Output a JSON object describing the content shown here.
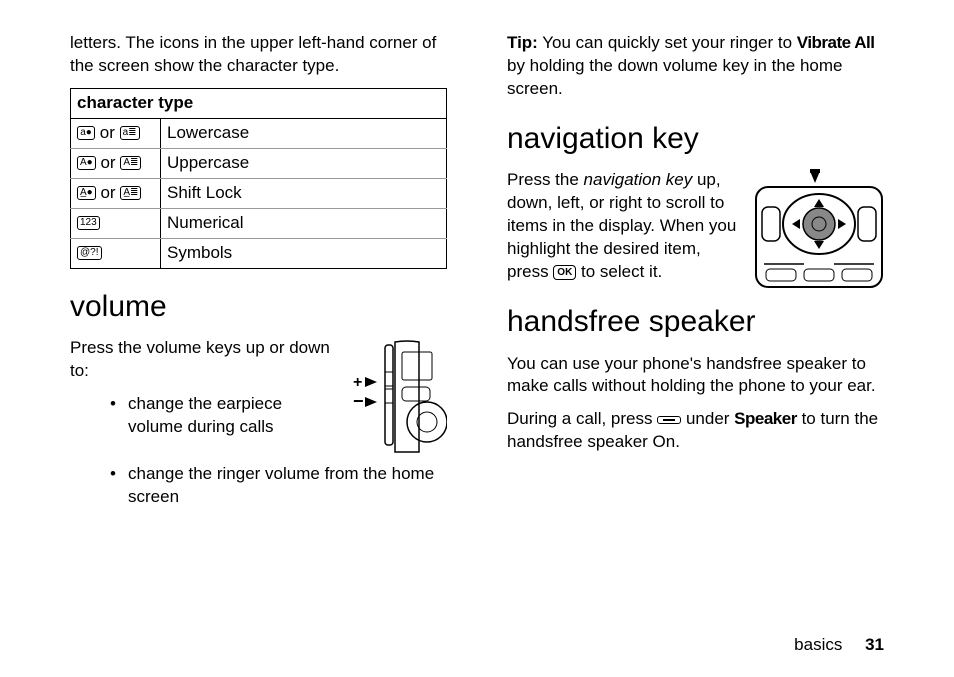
{
  "left": {
    "introText": "letters. The icons in the upper left-hand corner of the screen show the character type.",
    "tableHeader": "character type",
    "rows": [
      {
        "i1": "a●",
        "or": "or",
        "i2": "a≣",
        "label": "Lowercase"
      },
      {
        "i1": "A●",
        "or": "or",
        "i2": "A≣",
        "label": "Uppercase"
      },
      {
        "i1": "A̲●",
        "or": "or",
        "i2": "A̲≣",
        "label": "Shift Lock"
      },
      {
        "i1": "123",
        "or": "",
        "i2": "",
        "label": "Numerical"
      },
      {
        "i1": "@?!",
        "or": "",
        "i2": "",
        "label": "Symbols"
      }
    ],
    "volumeHeading": "volume",
    "volumeIntro": "Press the volume keys up or down to:",
    "bullet1": "change the earpiece volume during calls",
    "bullet2": "change the ringer volume from the home screen"
  },
  "right": {
    "tipLabel": "Tip:",
    "tipText1": " You can quickly set your ringer to ",
    "vibrateAll": "Vibrate All",
    "tipText2": " by holding the down volume key in the home screen.",
    "navHeading": "navigation key",
    "navText1": "Press the ",
    "navItalic": "navigation key",
    "navText2": " up, down, left, or right to scroll to items in the display. When you highlight the desired item, press ",
    "okKey": "OK",
    "navText3": " to select it.",
    "hfHeading": "handsfree speaker",
    "hfText": "You can use your phone's handsfree speaker to make calls without holding the phone to your ear.",
    "hfText2a": "During a call, press ",
    "hfText2b": " under ",
    "speaker": "Speaker",
    "hfText2c": " to turn the handsfree speaker On."
  },
  "footer": {
    "section": "basics",
    "page": "31"
  }
}
